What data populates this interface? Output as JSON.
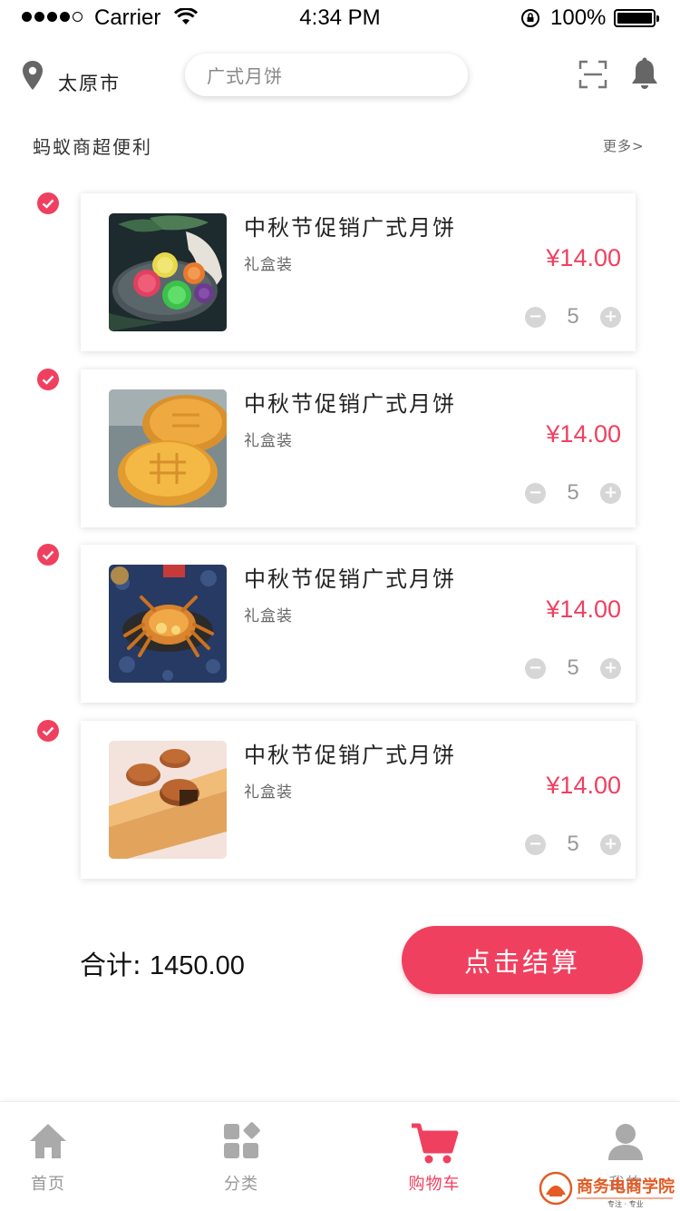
{
  "status_bar": {
    "carrier": "Carrier",
    "time": "4:34 PM",
    "battery": "100%"
  },
  "header": {
    "city": "太原市",
    "search_placeholder": "广式月饼"
  },
  "store": {
    "name": "蚂蚁商超便利",
    "more_label": "更多>"
  },
  "cart_items": [
    {
      "title": "中秋节促销广式月饼",
      "subtitle": "礼盒装",
      "price": "¥14.00",
      "qty": "5",
      "checked": true,
      "image": "colorful-mooncakes-on-plate"
    },
    {
      "title": "中秋节促销广式月饼",
      "subtitle": "礼盒装",
      "price": "¥14.00",
      "qty": "5",
      "checked": true,
      "image": "golden-mooncakes-closeup"
    },
    {
      "title": "中秋节促销广式月饼",
      "subtitle": "礼盒装",
      "price": "¥14.00",
      "qty": "5",
      "checked": true,
      "image": "crab-on-blue-cloth"
    },
    {
      "title": "中秋节促销广式月饼",
      "subtitle": "礼盒装",
      "price": "¥14.00",
      "qty": "5",
      "checked": true,
      "image": "mooncakes-on-wooden-board"
    }
  ],
  "summary": {
    "total_label": "合计:",
    "total_value": "1450.00",
    "checkout_label": "点击结算"
  },
  "tabs": [
    {
      "label": "首页",
      "icon": "home-icon",
      "active": false
    },
    {
      "label": "分类",
      "icon": "category-icon",
      "active": false
    },
    {
      "label": "购物车",
      "icon": "cart-icon",
      "active": true
    },
    {
      "label": "我的",
      "icon": "user-icon",
      "active": false
    }
  ],
  "watermark": {
    "text": "商务电商学院",
    "subtext": "专注 · 专业"
  },
  "colors": {
    "accent": "#f0405f",
    "muted": "#999999",
    "text": "#222222"
  }
}
